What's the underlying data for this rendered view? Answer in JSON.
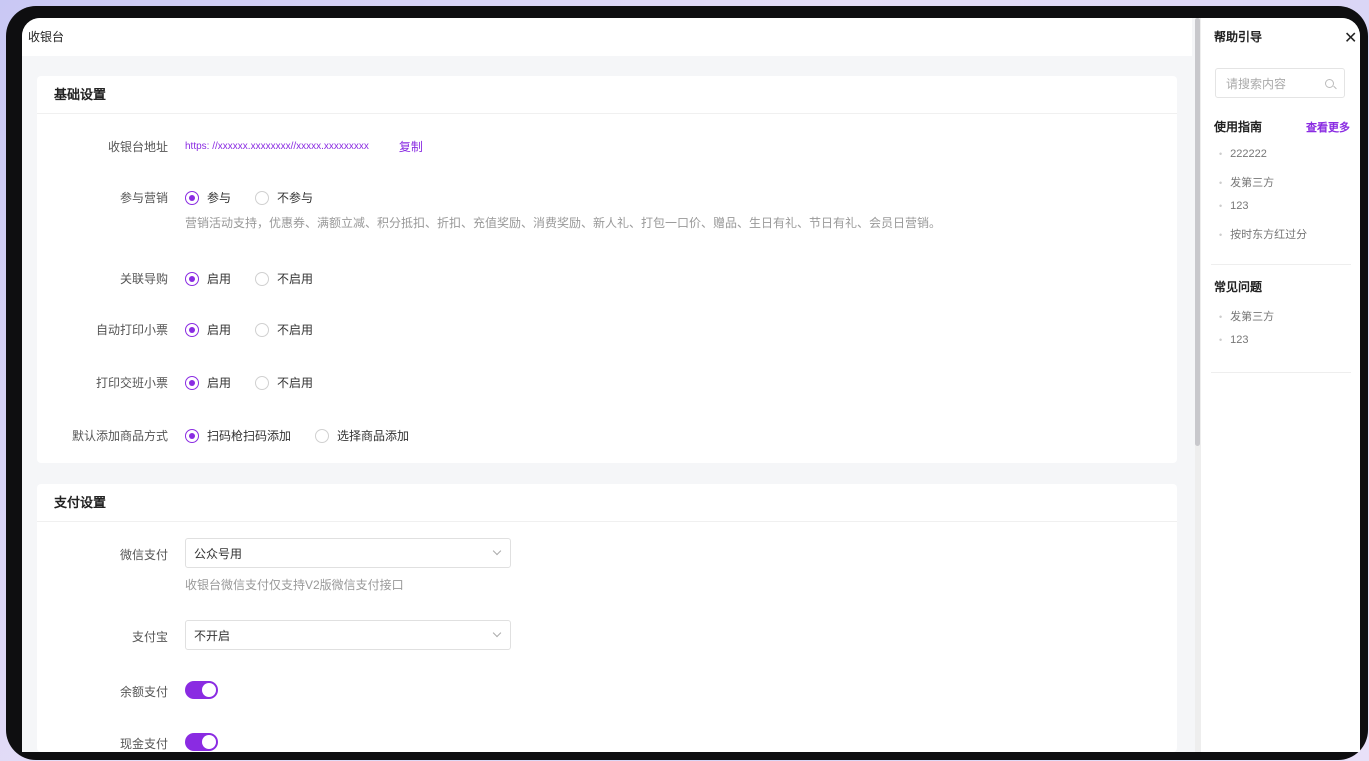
{
  "window": {
    "title": "收银台"
  },
  "basic": {
    "title": "基础设置",
    "address_label": "收银台地址",
    "address_value": "https: //xxxxxx.xxxxxxxx//xxxxx.xxxxxxxxx",
    "copy_label": "复制",
    "marketing_label": "参与营销",
    "marketing_opt1": "参与",
    "marketing_opt2": "不参与",
    "marketing_hint": "营销活动支持，优惠券、满额立减、积分抵扣、折扣、充值奖励、消费奖励、新人礼、打包一口价、赠品、生日有礼、节日有礼、会员日营销。",
    "guide_label": "关联导购",
    "guide_opt1": "启用",
    "guide_opt2": "不启用",
    "autoprint_label": "自动打印小票",
    "autoprint_opt1": "启用",
    "autoprint_opt2": "不启用",
    "shiftprint_label": "打印交班小票",
    "shiftprint_opt1": "启用",
    "shiftprint_opt2": "不启用",
    "addmode_label": "默认添加商品方式",
    "addmode_opt1": "扫码枪扫码添加",
    "addmode_opt2": "选择商品添加"
  },
  "payment": {
    "title": "支付设置",
    "wechat_label": "微信支付",
    "wechat_value": "公众号用",
    "wechat_hint": "收银台微信支付仅支持V2版微信支付接口",
    "alipay_label": "支付宝",
    "alipay_value": "不开启",
    "balance_label": "余额支付",
    "balance_on": true,
    "cash_label": "现金支付",
    "cash_on": true
  },
  "help": {
    "title": "帮助引导",
    "search_placeholder": "请搜索内容",
    "guide_title": "使用指南",
    "more": "查看更多",
    "guide_items": [
      "222222",
      "发第三方",
      "123",
      "按时东方红过分"
    ],
    "faq_title": "常见问题",
    "faq_items": [
      "发第三方",
      "123"
    ]
  },
  "colors": {
    "accent": "#8a2be2"
  }
}
